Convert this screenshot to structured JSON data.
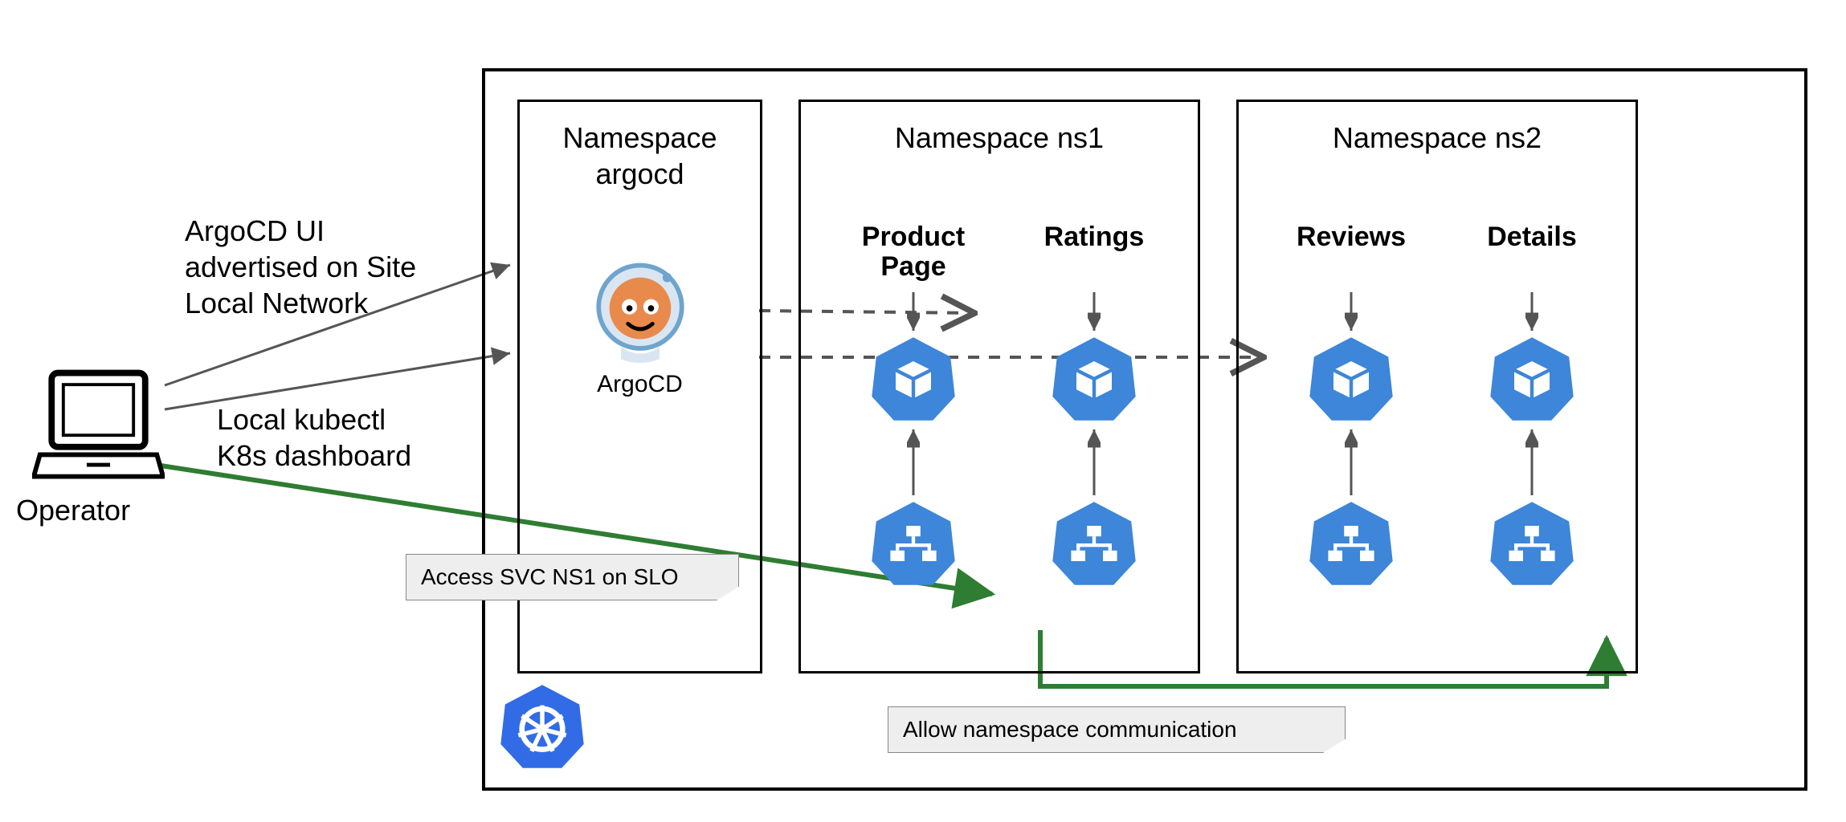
{
  "operator": {
    "label": "Operator",
    "note_ui": "ArgoCD UI\nadvertised on Site\nLocal Network",
    "note_kubectl": "Local kubectl\nK8s dashboard"
  },
  "cluster": {
    "namespaces": {
      "argocd": {
        "title": "Namespace\nargocd",
        "app": "ArgoCD"
      },
      "ns1": {
        "title": "Namespace\nns1",
        "cols": [
          {
            "name": "Product\nPage"
          },
          {
            "name": "Ratings"
          }
        ]
      },
      "ns2": {
        "title": "Namespace\nns2",
        "cols": [
          {
            "name": "Reviews"
          },
          {
            "name": "Details"
          }
        ]
      }
    },
    "note_svc": "Access SVC NS1 on SLO",
    "note_ns": "Allow namespace communication"
  }
}
